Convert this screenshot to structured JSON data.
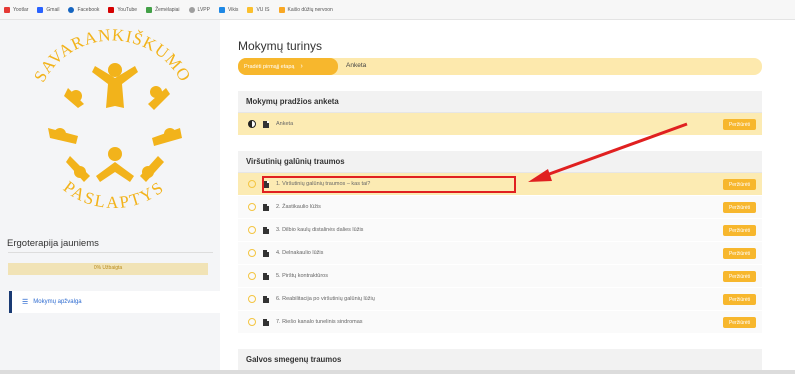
{
  "bookmarks": [
    {
      "label": "Yootlar",
      "color": "#e53935"
    },
    {
      "label": "Gmail",
      "color": "#2962ff"
    },
    {
      "label": "Facebook",
      "color": "#1565c0"
    },
    {
      "label": "YouTube",
      "color": "#d50000"
    },
    {
      "label": "Žemėlapiai",
      "color": "#43a047"
    },
    {
      "label": "LVPP",
      "color": "#9e9e9e"
    },
    {
      "label": "Vikis",
      "color": "#1e88e5"
    },
    {
      "label": "VU IS",
      "color": "#fbc02d"
    },
    {
      "label": "Kaišo dūžių nervoon",
      "color": "#f9a825"
    }
  ],
  "sidebar": {
    "logo_top": "SAVARANKIŠKUMO",
    "logo_bottom": "PASLAPTYS",
    "course_name": "Ergoterapija jauniems",
    "progress_text": "0% Užbaigta",
    "menu_item": "Mokymų apžvalga"
  },
  "main": {
    "title": "Mokymų turinys",
    "crumb_pill": "Pradėti pirmąjį etapą",
    "crumb_current": "Anketa",
    "sections": [
      {
        "title": "Mokymų pradžios anketa",
        "rows": [
          {
            "label": "Anketa",
            "button": "Peržiūrėti"
          }
        ]
      },
      {
        "title": "Viršutinių galūnių traumos",
        "rows": [
          {
            "label": "1. Viršutinių galūnių traumos – kas tai?",
            "button": "Peržiūrėti"
          },
          {
            "label": "2. Žastikaulio lūžis",
            "button": "Peržiūrėti"
          },
          {
            "label": "3. Dilbio kaulų distalinės dalies lūžis",
            "button": "Peržiūrėti"
          },
          {
            "label": "4. Delnakaulio lūžis",
            "button": "Peržiūrėti"
          },
          {
            "label": "5. Pirštų kontraktūros",
            "button": "Peržiūrėti"
          },
          {
            "label": "6. Reabilitacija po viršutinių galūnių lūžių",
            "button": "Peržiūrėti"
          },
          {
            "label": "7. Riešo kanalo tunelinis sindromas",
            "button": "Peržiūrėti"
          }
        ]
      },
      {
        "title": "Galvos smegenų traumos",
        "rows": []
      }
    ]
  },
  "colors": {
    "accent": "#f7b72d",
    "highlight_row": "#fcebb3",
    "annotation": "#e02020",
    "logo_gold": "#f2b31b",
    "nav_active": "#1a3b74"
  }
}
